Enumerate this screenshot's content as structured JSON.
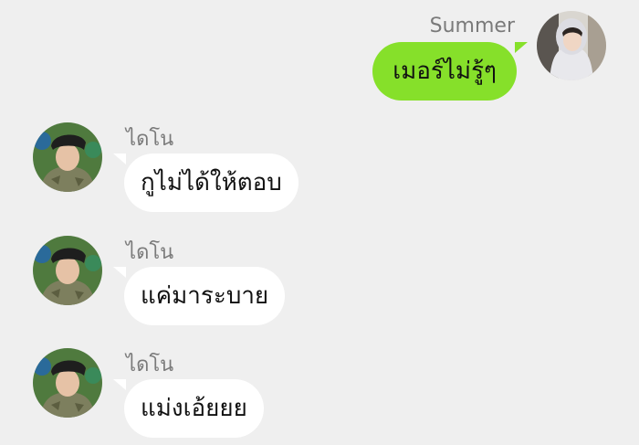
{
  "colors": {
    "background": "#efefef",
    "outgoing_bubble": "#86e02a",
    "incoming_bubble": "#ffffff",
    "sender_name": "#7a7a7a"
  },
  "messages": [
    {
      "sender": "Summer",
      "text": "เมอร์ไม่รู้ๆ",
      "direction": "outgoing",
      "avatar": "user-avatar-icon"
    },
    {
      "sender": "ไดโน",
      "text": "กูไม่ได้ให้ตอบ",
      "direction": "incoming",
      "avatar": "user-avatar-icon"
    },
    {
      "sender": "ไดโน",
      "text": "แค่มาระบาย",
      "direction": "incoming",
      "avatar": "user-avatar-icon"
    },
    {
      "sender": "ไดโน",
      "text": "แม่งเอ้ยยย",
      "direction": "incoming",
      "avatar": "user-avatar-icon"
    }
  ]
}
